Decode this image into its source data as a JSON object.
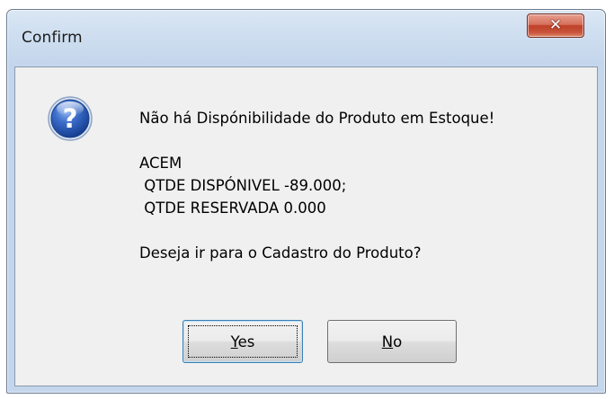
{
  "dialog": {
    "title": "Confirm",
    "close_glyph": "✕",
    "icon": "question-icon",
    "icon_glyph": "?",
    "message": {
      "line1": "Não há Dispónibilidade do Produto em Estoque!",
      "line2": "ACEM",
      "line3": " QTDE DISPÓNIVEL -89.000;",
      "line4": " QTDE RESERVADA 0.000",
      "line5": "Deseja ir para o Cadastro do Produto?"
    },
    "buttons": {
      "yes_mnemonic": "Y",
      "yes_rest": "es",
      "no_mnemonic": "N",
      "no_rest": "o"
    }
  },
  "colors": {
    "close_button": "#c8533a",
    "icon_blue": "#1f4fa8",
    "focus_border": "#3c7fb1"
  }
}
